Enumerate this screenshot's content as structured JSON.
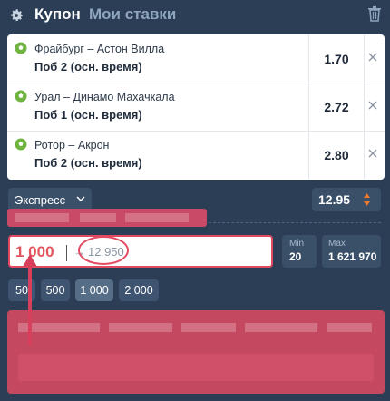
{
  "header": {
    "title": "Купон",
    "tab_my_bets": "Мои ставки"
  },
  "bets": [
    {
      "teams": "Фрайбург – Астон Вилла",
      "market": "Поб 2 (осн. время)",
      "odd": "1.70"
    },
    {
      "teams": "Урал – Динамо Махачкала",
      "market": "Поб 1 (осн. время)",
      "odd": "2.72"
    },
    {
      "teams": "Ротор – Акрон",
      "market": "Поб 2 (осн. время)",
      "odd": "2.80"
    }
  ],
  "express": {
    "label": "Экспресс",
    "total_odd": "12.95"
  },
  "stake": {
    "value": "1 000",
    "arrow": "→",
    "payout": "12 950"
  },
  "limits": {
    "min_label": "Min",
    "min_value": "20",
    "max_label": "Max",
    "max_value": "1 621 970"
  },
  "quick_amounts": [
    "50",
    "500",
    "1 000",
    "2 000"
  ],
  "colors": {
    "background": "#2b3e55",
    "accent_red": "#e24a62",
    "highlight": "#c4485f"
  }
}
